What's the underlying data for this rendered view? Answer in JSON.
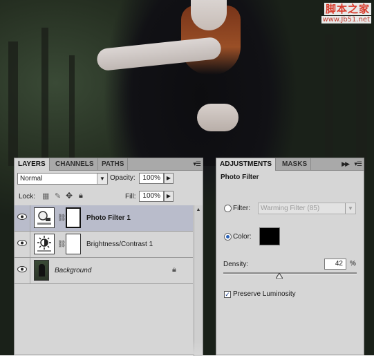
{
  "watermark": {
    "title": "脚本之家",
    "url": "www.Jb51.net"
  },
  "layers_panel": {
    "tabs": [
      "LAYERS",
      "CHANNELS",
      "PATHS"
    ],
    "blend_mode": "Normal",
    "opacity_label": "Opacity:",
    "opacity_value": "100%",
    "lock_label": "Lock:",
    "fill_label": "Fill:",
    "fill_value": "100%",
    "layers": [
      {
        "name": "Photo Filter 1",
        "selected": true,
        "icon": "photo-filter-icon"
      },
      {
        "name": "Brightness/Contrast 1",
        "selected": false,
        "icon": "brightness-contrast-icon"
      },
      {
        "name": "Background",
        "selected": false,
        "icon": "background-thumbnail",
        "locked": true
      }
    ]
  },
  "adjustments_panel": {
    "tabs": [
      "ADJUSTMENTS",
      "MASKS"
    ],
    "title": "Photo Filter",
    "filter_label": "Filter:",
    "filter_value": "Warming Filter (85)",
    "color_label": "Color:",
    "color_value": "#000000",
    "selected_option": "color",
    "density_label": "Density:",
    "density_value": "42",
    "density_unit": "%",
    "density_level": 0.42,
    "preserve_label": "Preserve Luminosity",
    "preserve_checked": true
  }
}
